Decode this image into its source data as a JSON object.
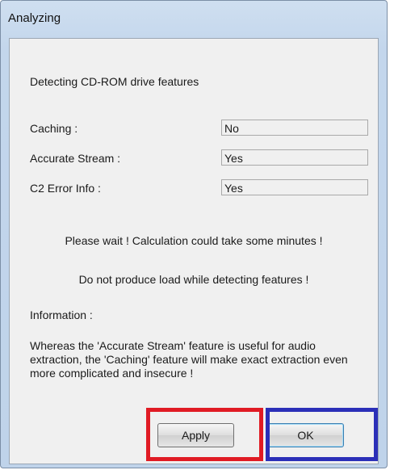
{
  "window": {
    "title": "Analyzing"
  },
  "heading": "Detecting CD-ROM drive features",
  "features": [
    {
      "label": "Caching :",
      "value": "No"
    },
    {
      "label": "Accurate Stream :",
      "value": "Yes"
    },
    {
      "label": "C2 Error Info :",
      "value": "Yes"
    }
  ],
  "messages": {
    "wait": "Please wait !  Calculation could take some minutes !",
    "load": "Do not produce load while detecting features !"
  },
  "information": {
    "label": "Information :",
    "text": "Whereas the 'Accurate Stream' feature is useful for audio extraction, the 'Caching' feature will make exact extraction even more complicated and insecure !"
  },
  "buttons": {
    "apply": "Apply",
    "ok": "OK"
  },
  "highlights": {
    "apply_color": "#e01b24",
    "ok_color": "#2b2fb8"
  }
}
